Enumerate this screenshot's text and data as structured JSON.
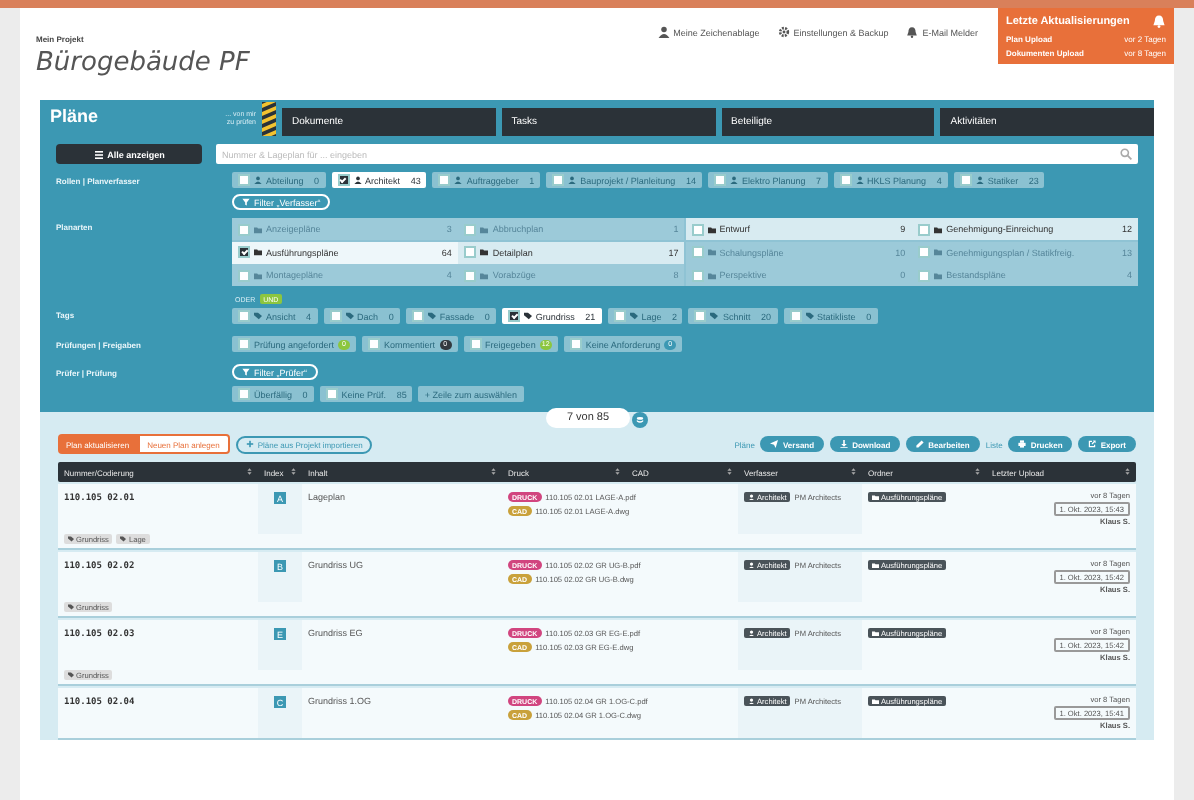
{
  "header": {
    "project_label": "Mein Projekt",
    "project_title": "Bürogebäude PF",
    "links": [
      {
        "kind": "user",
        "label": "Meine Zeichenablage"
      },
      {
        "kind": "gear",
        "label": "Einstellungen & Backup"
      },
      {
        "kind": "bell",
        "label": "E-Mail Melder"
      }
    ],
    "updates": {
      "title": "Letzte Aktualisierungen",
      "items": [
        {
          "label": "Plan Upload",
          "time": "vor 2 Tagen"
        },
        {
          "label": "Dokumenten Upload",
          "time": "vor 8 Tagen"
        }
      ]
    }
  },
  "tabs": [
    {
      "label": "Pläne",
      "selected": true
    },
    {
      "label": "Dokumente",
      "selected": false
    },
    {
      "label": "Tasks",
      "selected": false
    },
    {
      "label": "Beteiligte",
      "selected": false
    },
    {
      "label": "Aktivitäten",
      "selected": false
    }
  ],
  "review_hint": "... von mir zu prüfen",
  "show_all_button": "Alle anzeigen",
  "search": {
    "placeholder": "Nummer & Lageplan für ... eingeben"
  },
  "roles": {
    "label": "Rollen | Planverfasser",
    "chips": [
      {
        "label": "Abteilung",
        "count": "0",
        "checked": false
      },
      {
        "label": "Architekt",
        "count": "43",
        "checked": true
      },
      {
        "label": "Auftraggeber",
        "count": "1",
        "checked": false
      },
      {
        "label": "Bauprojekt / Planleitung",
        "count": "14",
        "checked": false
      },
      {
        "label": "Elektro Planung",
        "count": "7",
        "checked": false
      },
      {
        "label": "HKLS Planung",
        "count": "4",
        "checked": false
      },
      {
        "label": "Statiker",
        "count": "23",
        "checked": false
      }
    ],
    "filter_button": "Filter „Verfasser“"
  },
  "plan_types": {
    "label": "Planarten",
    "items": [
      {
        "label": "Anzeigepläne",
        "count": "3",
        "checked": false,
        "disabled": true
      },
      {
        "label": "Abbruchplan",
        "count": "1",
        "checked": false,
        "disabled": true
      },
      {
        "label": "Entwurf",
        "count": "9",
        "checked": false,
        "disabled": false
      },
      {
        "label": "Genehmigung-Einreichung",
        "count": "12",
        "checked": false,
        "disabled": false
      },
      {
        "label": "Ausführungspläne",
        "count": "64",
        "checked": true,
        "disabled": false
      },
      {
        "label": "Detailplan",
        "count": "17",
        "checked": false,
        "disabled": false
      },
      {
        "label": "Schalungspläne",
        "count": "10",
        "checked": false,
        "disabled": true
      },
      {
        "label": "Genehmigungsplan / Statikfreig.",
        "count": "13",
        "checked": false,
        "disabled": true
      },
      {
        "label": "Montagepläne",
        "count": "4",
        "checked": false,
        "disabled": true
      },
      {
        "label": "Vorabzüge",
        "count": "8",
        "checked": false,
        "disabled": true
      },
      {
        "label": "Perspektive",
        "count": "0",
        "checked": false,
        "disabled": true
      },
      {
        "label": "Bestandspläne",
        "count": "4",
        "checked": false,
        "disabled": true
      }
    ]
  },
  "tags": {
    "label": "Tags",
    "modes": [
      {
        "label": "ODER",
        "selected": false
      },
      {
        "label": "UND",
        "selected": true
      }
    ],
    "chips": [
      {
        "label": "Ansicht",
        "count": "4",
        "checked": false
      },
      {
        "label": "Dach",
        "count": "0",
        "checked": false
      },
      {
        "label": "Fassade",
        "count": "0",
        "checked": false
      },
      {
        "label": "Grundriss",
        "count": "21",
        "checked": true
      },
      {
        "label": "Lage",
        "count": "2",
        "checked": false
      },
      {
        "label": "Schnitt",
        "count": "20",
        "checked": false
      },
      {
        "label": "Statikliste",
        "count": "0",
        "checked": false
      }
    ]
  },
  "reviews": {
    "label": "Prüfungen | Freigaben",
    "chips": [
      {
        "label": "Prüfung angefordert",
        "count": "0",
        "color": "#8cc63f",
        "checked": false
      },
      {
        "label": "Kommentiert",
        "count": "0",
        "color": "#333a40",
        "checked": false
      },
      {
        "label": "Freigegeben",
        "count": "12",
        "color": "#8cc63f",
        "checked": false
      },
      {
        "label": "Keine Anforderung",
        "count": "0",
        "color": "#3c98b3",
        "checked": false
      }
    ]
  },
  "reviewers": {
    "label": "Prüfer | Prüfung",
    "filter_button": "Filter „Prüfer“",
    "chips": [
      {
        "label": "Überfällig",
        "count": "0",
        "checked": false
      },
      {
        "label": "Keine Prüf.",
        "count": "85",
        "checked": false
      }
    ],
    "add_button": "+ Zeile zum auswählen"
  },
  "result_count": "7 von 85",
  "actions": {
    "primary": "Plan aktualisieren",
    "secondary": "Neuen Plan anlegen",
    "import": "Pläne aus Projekt importieren",
    "plans_label": "Pläne",
    "plan_buttons": [
      {
        "kind": "send",
        "label": "Versand"
      },
      {
        "kind": "download",
        "label": "Download"
      },
      {
        "kind": "edit",
        "label": "Bearbeiten"
      }
    ],
    "list_label": "Liste",
    "list_buttons": [
      {
        "kind": "print",
        "label": "Drucken"
      },
      {
        "kind": "export",
        "label": "Export"
      }
    ]
  },
  "table": {
    "columns": [
      "Nummer/Codierung",
      "Index",
      "Inhalt",
      "Druck",
      "CAD",
      "Verfasser",
      "Ordner",
      "Letzter Upload"
    ],
    "rows": [
      {
        "number": "110.105 02.01",
        "index": "A",
        "content": "Lageplan",
        "print_badge": "DRUCK",
        "print_file": "110.105 02.01 LAGE-A.pdf",
        "cad_badge": "CAD",
        "cad_file": "110.105 02.01 LAGE-A.dwg",
        "role": "Architekt",
        "author": "PM Architects",
        "folder": "Ausführungspläne",
        "upload_age": "vor 8 Tagen",
        "upload_date": "1. Okt. 2023, 15:43",
        "uploader": "Klaus S.",
        "tags": [
          "Grundriss",
          "Lage"
        ]
      },
      {
        "number": "110.105 02.02",
        "index": "B",
        "content": "Grundriss UG",
        "print_badge": "DRUCK",
        "print_file": "110.105 02.02 GR UG-B.pdf",
        "cad_badge": "CAD",
        "cad_file": "110.105 02.02 GR UG-B.dwg",
        "role": "Architekt",
        "author": "PM Architects",
        "folder": "Ausführungspläne",
        "upload_age": "vor 8 Tagen",
        "upload_date": "1. Okt. 2023, 15:42",
        "uploader": "Klaus S.",
        "tags": [
          "Grundriss"
        ]
      },
      {
        "number": "110.105 02.03",
        "index": "E",
        "content": "Grundriss EG",
        "print_badge": "DRUCK",
        "print_file": "110.105 02.03 GR EG-E.pdf",
        "cad_badge": "CAD",
        "cad_file": "110.105 02.03 GR EG-E.dwg",
        "role": "Architekt",
        "author": "PM Architects",
        "folder": "Ausführungspläne",
        "upload_age": "vor 8 Tagen",
        "upload_date": "1. Okt. 2023, 15:42",
        "uploader": "Klaus S.",
        "tags": [
          "Grundriss"
        ]
      },
      {
        "number": "110.105 02.04",
        "index": "C",
        "content": "Grundriss 1.OG",
        "print_badge": "DRUCK",
        "print_file": "110.105 02.04 GR 1.OG-C.pdf",
        "cad_badge": "CAD",
        "cad_file": "110.105 02.04 GR 1.OG-C.dwg",
        "role": "Architekt",
        "author": "PM Architects",
        "folder": "Ausführungspläne",
        "upload_age": "vor 8 Tagen",
        "upload_date": "1. Okt. 2023, 15:41",
        "uploader": "Klaus S.",
        "tags": []
      }
    ]
  }
}
